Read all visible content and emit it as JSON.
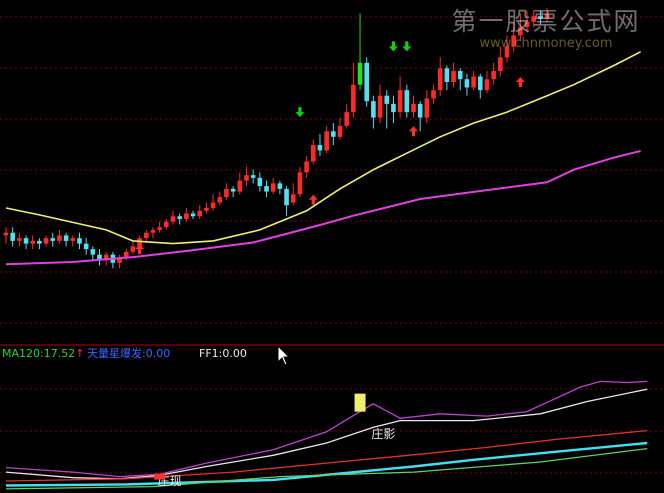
{
  "watermark": {
    "line1": "第一股票公式网",
    "line2": "www.chnmoney.com"
  },
  "legend": {
    "ma120_label": "MA120:17.52",
    "ma120_arrow": "↑",
    "signal_label": "天量星爆发:0.00",
    "ff1_label": "FF1:0.00"
  },
  "colors": {
    "background": "#000000",
    "grid": "#7a0000",
    "bull": "#ff2b2b",
    "bear": "#55e0ee",
    "ma_short": "#f0f070",
    "ma_long": "#e040e0",
    "arrow_up": "#ff3030",
    "arrow_down": "#10d010",
    "highlight_candle": "#22e022",
    "label_red": "#ff5050",
    "label_blue": "#3d64ff",
    "label_white": "#e8e8e8",
    "ind_white": "#e8e8e8",
    "ind_magenta": "#c040d0",
    "ind_red": "#e03030",
    "ind_cyan": "#40e0f0",
    "ind_green": "#60d060"
  },
  "chart_data": [
    {
      "type": "candlestick",
      "title": "",
      "xlabel": "",
      "ylabel": "",
      "grid": true,
      "ylim": [
        0,
        100
      ],
      "series": [
        {
          "type": "candles",
          "values": [
            [
              17,
              18,
              14,
              20
            ],
            [
              18,
              15,
              13,
              20
            ],
            [
              15,
              16,
              13,
              18
            ],
            [
              16,
              14,
              12,
              17
            ],
            [
              14,
              15,
              12,
              17
            ],
            [
              15,
              14,
              12,
              16
            ],
            [
              14,
              16,
              13,
              17
            ],
            [
              16,
              15,
              13,
              18
            ],
            [
              15,
              17,
              14,
              19
            ],
            [
              17,
              15,
              13,
              18
            ],
            [
              15,
              16,
              13,
              17
            ],
            [
              16,
              14,
              12,
              18
            ],
            [
              14,
              12,
              10,
              16
            ],
            [
              12,
              10,
              8,
              13
            ],
            [
              10,
              8,
              6,
              12
            ],
            [
              8,
              10,
              6,
              11
            ],
            [
              10,
              7,
              5,
              11
            ],
            [
              7,
              9,
              5,
              10
            ],
            [
              9,
              11,
              8,
              12
            ],
            [
              11,
              13,
              10,
              15
            ],
            [
              13,
              16,
              12,
              17
            ],
            [
              16,
              18,
              15,
              19
            ],
            [
              18,
              19,
              16,
              20
            ],
            [
              19,
              20,
              18,
              22
            ],
            [
              20,
              22,
              19,
              23
            ],
            [
              22,
              24,
              21,
              26
            ],
            [
              24,
              23,
              21,
              25
            ],
            [
              23,
              25,
              22,
              27
            ],
            [
              25,
              24,
              23,
              26
            ],
            [
              24,
              26,
              23,
              28
            ],
            [
              26,
              27,
              25,
              29
            ],
            [
              27,
              29,
              26,
              32
            ],
            [
              29,
              31,
              28,
              33
            ],
            [
              31,
              34,
              30,
              36
            ],
            [
              34,
              33,
              31,
              35
            ],
            [
              33,
              37,
              32,
              40
            ],
            [
              37,
              39,
              35,
              42
            ],
            [
              39,
              38,
              36,
              41
            ],
            [
              38,
              35,
              33,
              40
            ],
            [
              35,
              33,
              31,
              37
            ],
            [
              33,
              36,
              32,
              38
            ],
            [
              36,
              34,
              32,
              37
            ],
            [
              34,
              28,
              24,
              35
            ],
            [
              29,
              32,
              28,
              36
            ],
            [
              32,
              40,
              31,
              42
            ],
            [
              40,
              44,
              38,
              46
            ],
            [
              44,
              50,
              43,
              52
            ],
            [
              50,
              48,
              46,
              54
            ],
            [
              48,
              55,
              47,
              57
            ],
            [
              55,
              53,
              50,
              58
            ],
            [
              53,
              57,
              52,
              60
            ],
            [
              57,
              62,
              56,
              65
            ],
            [
              62,
              72,
              60,
              80
            ],
            [
              72,
              80,
              70,
              98
            ],
            [
              80,
              66,
              64,
              82
            ],
            [
              66,
              60,
              56,
              68
            ],
            [
              60,
              68,
              58,
              72
            ],
            [
              68,
              65,
              56,
              70
            ],
            [
              65,
              62,
              58,
              68
            ],
            [
              62,
              70,
              60,
              75
            ],
            [
              70,
              62,
              60,
              72
            ],
            [
              62,
              65,
              60,
              68
            ],
            [
              65,
              60,
              55,
              66
            ],
            [
              60,
              67,
              58,
              70
            ],
            [
              67,
              70,
              65,
              72
            ],
            [
              70,
              78,
              68,
              82
            ],
            [
              78,
              73,
              70,
              79
            ],
            [
              73,
              77,
              71,
              80
            ],
            [
              77,
              74,
              70,
              78
            ],
            [
              74,
              71,
              68,
              76
            ],
            [
              71,
              75,
              70,
              77
            ],
            [
              75,
              70,
              67,
              76
            ],
            [
              70,
              74,
              69,
              77
            ],
            [
              74,
              77,
              72,
              80
            ],
            [
              77,
              82,
              75,
              86
            ],
            [
              82,
              86,
              80,
              90
            ],
            [
              86,
              90,
              84,
              95
            ],
            [
              90,
              93,
              88,
              98
            ],
            [
              93,
              95,
              91,
              99
            ],
            [
              95,
              97,
              93,
              99
            ],
            [
              97,
              96,
              94,
              99
            ],
            [
              96,
              98,
              95,
              100
            ]
          ]
        },
        {
          "name": "",
          "type": "line",
          "values": [
            [
              0,
              27
            ],
            [
              5,
              24.5
            ],
            [
              15,
              19
            ],
            [
              19,
              15
            ],
            [
              25,
              14
            ],
            [
              31,
              15
            ],
            [
              38,
              19
            ],
            [
              45,
              26
            ],
            [
              50,
              34
            ],
            [
              55,
              41
            ],
            [
              60,
              47
            ],
            [
              65,
              53
            ],
            [
              70,
              58
            ],
            [
              75,
              62
            ],
            [
              81,
              68
            ],
            [
              85,
              72
            ],
            [
              91,
              79
            ],
            [
              95,
              84
            ]
          ]
        },
        {
          "name": "MA120",
          "type": "line",
          "values": [
            [
              0,
              6.5
            ],
            [
              10,
              7.3
            ],
            [
              19,
              9.1
            ],
            [
              27,
              11.3
            ],
            [
              37,
              14.4
            ],
            [
              47,
              20.8
            ],
            [
              52,
              24.2
            ],
            [
              62,
              30.3
            ],
            [
              71,
              33.2
            ],
            [
              81,
              36.4
            ],
            [
              85,
              41
            ],
            [
              91,
              45.4
            ],
            [
              95,
              47.8
            ]
          ]
        }
      ],
      "annotations": [
        {
          "type": "arrow_up",
          "x": 20,
          "y": 12
        },
        {
          "type": "arrow_up",
          "x": 46,
          "y": 30
        },
        {
          "type": "arrow_down",
          "x": 44,
          "y": 62
        },
        {
          "type": "arrow_up",
          "x": 61,
          "y": 55
        },
        {
          "type": "arrow_down",
          "x": 58,
          "y": 86
        },
        {
          "type": "arrow_down",
          "x": 60,
          "y": 86
        },
        {
          "type": "arrow_up",
          "x": 77,
          "y": 73
        }
      ],
      "highlight_index": 53
    },
    {
      "type": "line",
      "title": "",
      "xlabel": "",
      "ylabel": "",
      "grid": true,
      "ylim": [
        0,
        100
      ],
      "series": [
        {
          "name": "",
          "color_key": "ind_white",
          "values": [
            [
              0,
              16
            ],
            [
              10,
              11
            ],
            [
              17,
              10
            ],
            [
              23,
              13
            ],
            [
              30,
              21
            ],
            [
              40,
              31
            ],
            [
              48,
              42
            ],
            [
              55,
              56
            ],
            [
              59,
              62
            ],
            [
              63,
              62
            ],
            [
              70,
              62
            ],
            [
              80,
              68
            ],
            [
              87,
              79
            ],
            [
              96,
              90
            ]
          ]
        },
        {
          "name": "",
          "color_key": "ind_magenta",
          "values": [
            [
              0,
              20
            ],
            [
              10,
              16
            ],
            [
              17,
              12
            ],
            [
              23,
              14
            ],
            [
              30,
              24
            ],
            [
              40,
              36
            ],
            [
              48,
              52
            ],
            [
              53,
              70
            ],
            [
              55,
              77
            ],
            [
              59,
              64
            ],
            [
              65,
              68
            ],
            [
              72,
              66
            ],
            [
              78,
              70
            ],
            [
              82,
              81
            ],
            [
              86,
              92
            ],
            [
              89,
              97
            ],
            [
              93,
              96
            ],
            [
              96,
              97
            ]
          ]
        },
        {
          "name": "",
          "color_key": "ind_red",
          "values": [
            [
              0,
              8
            ],
            [
              18,
              10
            ],
            [
              34,
              16
            ],
            [
              48,
              24
            ],
            [
              62,
              32
            ],
            [
              72,
              38
            ],
            [
              82,
              45
            ],
            [
              96,
              53
            ]
          ]
        },
        {
          "name": "",
          "color_key": "ind_cyan",
          "values": [
            [
              0,
              4
            ],
            [
              18,
              5
            ],
            [
              40,
              9
            ],
            [
              61,
              21
            ],
            [
              70,
              27
            ],
            [
              82,
              34
            ],
            [
              96,
              42
            ]
          ]
        },
        {
          "name": "",
          "color_key": "ind_green",
          "values": [
            [
              0,
              1
            ],
            [
              22,
              3
            ],
            [
              41,
              12
            ],
            [
              61,
              16
            ],
            [
              80,
              25
            ],
            [
              96,
              37
            ]
          ]
        }
      ],
      "annotations": [
        {
          "type": "text",
          "text": "庄影",
          "x": 55,
          "y": 50
        },
        {
          "type": "text",
          "text": "庄现",
          "x": 23,
          "y": 8
        },
        {
          "type": "bar",
          "color_key": "arrow_up",
          "x": 23,
          "y": 12
        },
        {
          "type": "bar",
          "color_key": "ma_short",
          "x": 53,
          "y": 78
        }
      ]
    }
  ]
}
